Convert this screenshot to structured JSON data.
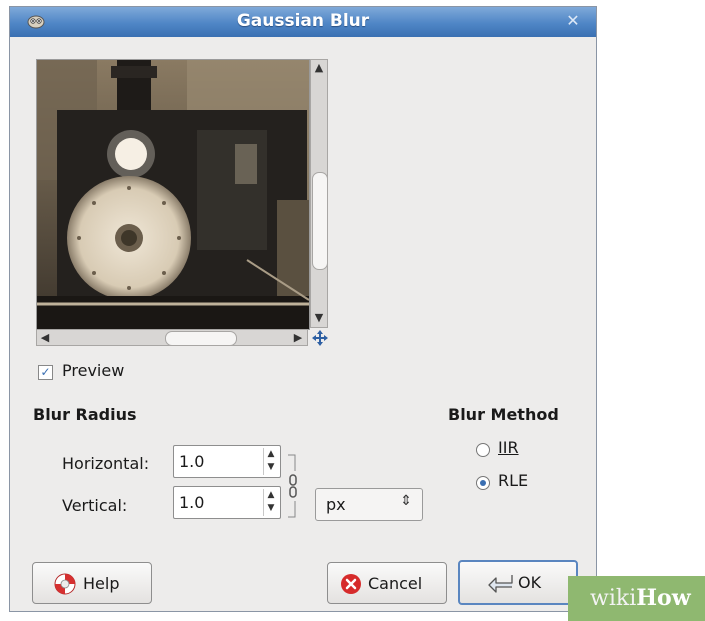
{
  "window": {
    "title": "Gaussian Blur",
    "close_icon": "close-icon",
    "app_icon": "gimp-wilber-icon"
  },
  "preview": {
    "label": "Preview",
    "checked": true,
    "image_description": "sepia photo of steam locomotive front"
  },
  "blur_radius": {
    "heading": "Blur Radius",
    "horizontal_label": "Horizontal:",
    "horizontal_value": "1.0",
    "vertical_label": "Vertical:",
    "vertical_value": "1.0",
    "unit": "px"
  },
  "blur_method": {
    "heading": "Blur Method",
    "options": [
      {
        "label": "IIR",
        "selected": false
      },
      {
        "label": "RLE",
        "selected": true
      }
    ]
  },
  "buttons": {
    "help": "Help",
    "cancel": "Cancel",
    "ok": "OK"
  },
  "watermark": {
    "part1": "wiki",
    "part2": "How"
  },
  "colors": {
    "titlebar": "#4f86c6",
    "dialog_bg": "#edeceb",
    "accent": "#3a6fb2",
    "watermark_bg": "#8fb870"
  }
}
